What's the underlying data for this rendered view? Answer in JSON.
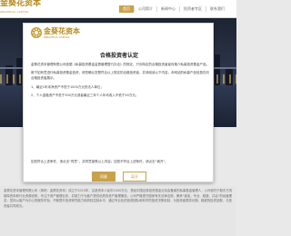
{
  "header": {
    "brand_name": "金葵花资本",
    "brand_sub": "JINKUIHUA CAPITAL",
    "nav": [
      "首页",
      "公司简介",
      "新闻中心",
      "投资者专区",
      "联系我们",
      "联系方式",
      "加入我们"
    ]
  },
  "modal": {
    "brand_name": "金葵花资本",
    "brand_sub": "JINKUIHUA CAPITAL",
    "title": "合格投资者认定",
    "intro": "金葵花资本管理有限公司依据《私募投资基金监督管理暂行办法》的规定，只向特定的合格投资者宣传推介私募投资基金产品。",
    "intro2": "阁下如有意进行私募投资基金投资，请您确认您是符合以上规定的合格投资者，并请阅读以下内容，本网站的私募产品信息仅向合格投资者展示。",
    "conditions": [
      "1、最近1年末净资产不低于1000万元的法人单位；",
      "2、个人金融资产不低于300万元或者最近三年个人年均收入不低于50万元。"
    ],
    "confirm": "如您符合上述条件，请点击“同意”，并同意接受以上内容；如您不符合上述条件，请点击“离开”。",
    "accept_label": "同意",
    "leave_label": "离开"
  },
  "footer": {
    "text": "金葵花资本管理有限公司（简称：金葵花资本）成立于2015年，注册资本人民币1000万元，是经中国证券投资基金业协会备案的私募基金管理人，公司依托于股东方的雄厚资本和行业资源优势，专注于资产管理业务，并致力于为客户提供优质的资产管理服务。公司严格遵守国家有关法律法规，秉承“诚信、专业、稳健、共赢”的经营理念，坚持以客户为中心的服务宗旨，不断提升投资研究能力和风险控制水平，通过专业化的投资团队和科学的投资决策机制，为投资者提供长期、稳健的投资回报，与投资者共同成长。"
  }
}
